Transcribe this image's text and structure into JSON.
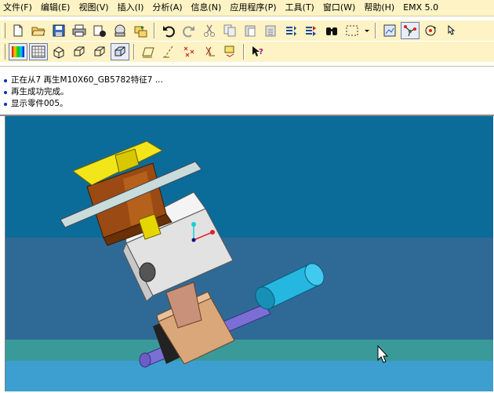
{
  "menu": [
    {
      "id": "file",
      "label": "文件(F)"
    },
    {
      "id": "edit",
      "label": "编辑(E)"
    },
    {
      "id": "view",
      "label": "视图(V)"
    },
    {
      "id": "insert",
      "label": "插入(I)"
    },
    {
      "id": "analysis",
      "label": "分析(A)"
    },
    {
      "id": "info",
      "label": "信息(N)"
    },
    {
      "id": "applications",
      "label": "应用程序(P)"
    },
    {
      "id": "tools",
      "label": "工具(T)"
    },
    {
      "id": "window",
      "label": "窗口(W)"
    },
    {
      "id": "help",
      "label": "帮助(H)"
    },
    {
      "id": "emx",
      "label": "EMX 5.0"
    }
  ],
  "toolbar1": [
    "new-icon",
    "open-icon",
    "save-icon",
    "print-icon",
    "send-icon",
    "email-icon",
    "folder-arrow-icon",
    "undo-icon",
    "redo-icon",
    "cut-icon",
    "copy-icon",
    "paste-icon",
    "paste-special-icon",
    "regenerate-icon",
    "regen-manager-icon",
    "find-icon",
    "select-box-icon",
    "dropdown-icon",
    "view-mode-icon",
    "datum-display-icon",
    "spin-center-icon",
    "pointer-icon"
  ],
  "toolbar2": [
    "shading-icon",
    "hidden-line-icon",
    "wireframe-icon",
    "no-hidden-icon",
    "shaded-icon",
    "model-tree-icon",
    "datum-plane-icon",
    "datum-axis-icon",
    "datum-point-icon",
    "coordinate-system-icon",
    "annotation-icon",
    "whats-this-icon"
  ],
  "messages": [
    "正在从7 再生M10X60_GB5782特征7 ...",
    "再生成功完成。",
    "显示零件005。"
  ],
  "colors": {
    "toolbar_bg": "#fdf3c4",
    "viewport_top": "#0c6c99",
    "viewport_band": "#2f6a97",
    "viewport_teal": "#3a9a9a",
    "viewport_bottom": "#3d9ed0"
  }
}
